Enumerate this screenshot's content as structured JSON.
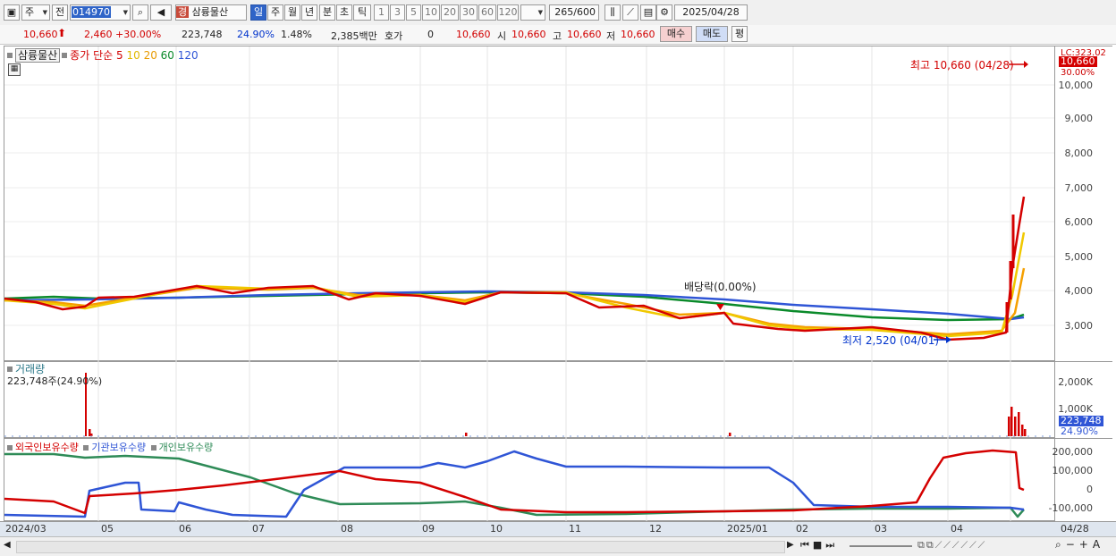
{
  "toolbar": {
    "market_select": "주",
    "prev_label": "전",
    "code": "014970",
    "stock_badge": "경",
    "stock_name": "삼륭물산",
    "periods": [
      "일",
      "주",
      "월",
      "년",
      "분",
      "초",
      "틱"
    ],
    "active_period": "일",
    "intervals": [
      "1",
      "3",
      "5",
      "10",
      "20",
      "30",
      "60",
      "120"
    ],
    "count": "265",
    "count_total": "/600",
    "date": "2025/04/28"
  },
  "quote": {
    "price": "10,660",
    "change": "2,460",
    "change_pct": "+30.00%",
    "volume": "223,748",
    "volume_ratio": "24.90%",
    "turnover": "1.48%",
    "amount": "2,385백만",
    "bid_label": "호가",
    "bid_value": "0",
    "close": "10,660",
    "open_label": "시",
    "open": "10,660",
    "high_label": "고",
    "high": "10,660",
    "low_label": "저",
    "low": "10,660",
    "buy_label": "매수",
    "sell_label": "매도",
    "avg_label": "평"
  },
  "price_panel": {
    "stock_label": "삼륭물산",
    "ma_title": "종가 단순",
    "ma_periods": [
      "5",
      "10",
      "20",
      "60",
      "120"
    ],
    "ma_colors": [
      "#d40000",
      "#f0c800",
      "#f5a000",
      "#0a8a2a",
      "#2f55d6"
    ],
    "high_note": "최고 10,660 (04/28)",
    "low_note": "최저 2,520 (04/01)",
    "dividend_note": "배당락(0.00%)",
    "current_tag": "10,660",
    "top_tag": "30.00%",
    "top_tag2": "LC:323.02",
    "y_ticks": [
      "10,000",
      "9,000",
      "8,000",
      "7,000",
      "6,000",
      "5,000",
      "4,000",
      "3,000"
    ]
  },
  "volume_panel": {
    "title": "거래량",
    "value_text": "223,748주(24.90%)",
    "y_ticks": [
      "2,000K",
      "1,000K"
    ],
    "current_tag": "223,748",
    "ratio_tag": "24.90%"
  },
  "holding_panel": {
    "series": [
      "외국인보유수량",
      "기관보유수량",
      "개인보유수량"
    ],
    "series_colors": [
      "#d40000",
      "#2f55d6",
      "#2e8b57"
    ],
    "y_ticks": [
      "200,000",
      "100,000",
      "0",
      "-100,000"
    ]
  },
  "x_labels": [
    "2024/03",
    "05",
    "06",
    "07",
    "08",
    "09",
    "10",
    "11",
    "12",
    "2025/01",
    "02",
    "03",
    "04"
  ],
  "x_right_label": "04/28",
  "chart_data": {
    "type": "line",
    "title": "",
    "ylim": [
      2500,
      11000
    ],
    "price_approx": {
      "dates": [
        "2024/03",
        "05",
        "06",
        "07",
        "08",
        "09",
        "10",
        "11",
        "12",
        "2025/01",
        "02",
        "03",
        "04/01",
        "04/28"
      ],
      "close": [
        3700,
        3800,
        4000,
        4100,
        3800,
        3800,
        3950,
        3800,
        3400,
        3200,
        3000,
        2900,
        2520,
        10660
      ]
    },
    "volume_peak_label": "2,000K",
    "holding_ylim": [
      -100000,
      200000
    ]
  }
}
